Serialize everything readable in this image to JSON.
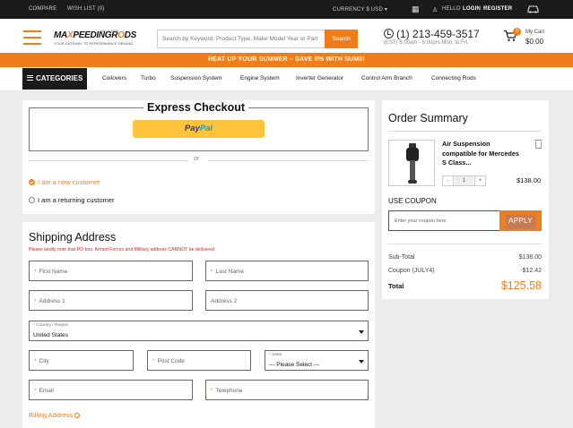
{
  "topbar": {
    "compare": "COMPARE",
    "wishlist": "WISH LIST (0)",
    "currency": "CURRENCY",
    "currency_value": "$ USD",
    "greeting": "HELLO",
    "login": "LOGIN",
    "register": "REGISTER"
  },
  "header": {
    "logo_text_a": "MA",
    "logo_text_b": "X",
    "logo_text_c": "PEEDINGR",
    "logo_text_d": "O",
    "logo_text_e": "DS",
    "logo_since": "Since 2006",
    "logo_tagline": "YOUR GATEWAY TO PERFORMANCE DRIVING",
    "search_placeholder": "Search by Keyword, Product Type, Make Model Year or Part",
    "search_button": "Search",
    "phone": "(1) 213-459-3517",
    "hours": "(EST) 8:00am - 6:00pm Mon. to Fri.",
    "cart_count": "0",
    "cart_label": "My Cart",
    "cart_total": "$0.00"
  },
  "promo": "HEAT UP YOUR SUMMER – SAVE 8% WITH SUM8!",
  "nav": {
    "categories": "CATEGORIES",
    "items": [
      "Coilovers",
      "Turbo",
      "Suspension System",
      "Engine System",
      "Inverter Generator",
      "Control Arm Branch",
      "Connecting Rods"
    ]
  },
  "express": {
    "title": "Express Checkout",
    "paypal_a": "Pay",
    "paypal_b": "Pal",
    "or": "or"
  },
  "customer": {
    "new": "I am a new customer",
    "returning": "I am a returning customer"
  },
  "shipping": {
    "title": "Shipping Address",
    "note": "Please kindly note that PO box, Armed Forces and Military address CANNOT be delivered",
    "required_mark": "*",
    "first_name": "First Name",
    "last_name": "Last Name",
    "address1": "Address 1",
    "address2": "Address 2",
    "country_label": "Country / Region",
    "country_value": "United States",
    "city": "City",
    "postcode": "Post Code",
    "state_label": "State",
    "state_value": "--- Please Select ---",
    "email": "Email",
    "telephone": "Telephone",
    "billing": "Billing Address",
    "billing_info": "i"
  },
  "summary": {
    "title": "Order Summary",
    "product_name": "Air Suspension compatible for Mercedes S Class...",
    "qty_minus": "-",
    "qty": "1",
    "qty_plus": "+",
    "price": "$138.00",
    "coupon_label": "USE COUPON",
    "coupon_placeholder": "Enter your coupon here",
    "apply": "APPLY",
    "subtotal_label": "Sub-Total",
    "subtotal": "$138.00",
    "coupon_line_label": "Coupon (JULY4)",
    "coupon_line": "-$12.42",
    "total_label": "Total",
    "total": "$125.58"
  },
  "colors": {
    "accent": "#ef7d1a",
    "dark": "#1b1b1b",
    "paypal": "#ffc439"
  }
}
